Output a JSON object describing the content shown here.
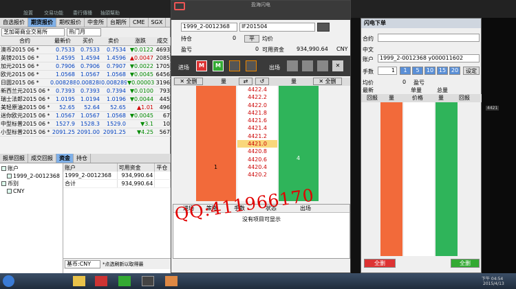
{
  "topmenu": [
    "設置",
    "交易功能",
    "委行傳播",
    "抽頭幫助"
  ],
  "main": {
    "tabs": [
      "自选报价",
      "期货报价",
      "期权报价",
      "中金所",
      "台期所",
      "CME",
      "SGX"
    ],
    "exchange": "芝加哥商业交易所",
    "month": "热门月",
    "cols": [
      "合约",
      "最新价",
      "买价",
      "卖价",
      "涨跌",
      "成交"
    ],
    "rows": [
      [
        "澳币2015 06 *",
        "0.7533",
        "0.7533",
        "0.7534",
        "▼0.0122",
        "4693"
      ],
      [
        "英镑2015 06 *",
        "1.4595",
        "1.4594",
        "1.4596",
        "▲0.0047",
        "2085"
      ],
      [
        "加元2015 06 *",
        "0.7906",
        "0.7906",
        "0.7907",
        "▼0.0022",
        "1705"
      ],
      [
        "欧元2015 06 *",
        "1.0568",
        "1.0567",
        "1.0568",
        "▼0.0045",
        "6456"
      ],
      [
        "日圆2015 06 *",
        "0.008288",
        "0.008288",
        "0.008289",
        "▼0.000039",
        "3196"
      ],
      [
        "新西兰元2015 06 *",
        "0.7393",
        "0.7393",
        "0.7394",
        "▼0.0100",
        "793"
      ],
      [
        "瑞士法郎2015 06 *",
        "1.0195",
        "1.0194",
        "1.0196",
        "▼0.0044",
        "445"
      ],
      [
        "美轻原油2015 06 *",
        "52.65",
        "52.64",
        "52.65",
        "▲1.01",
        "496"
      ],
      [
        "迷你欧元2015 06 *",
        "1.0567",
        "1.0567",
        "1.0568",
        "▼0.0045",
        "67"
      ],
      [
        "中型标普2015 06 *",
        "1527.9",
        "1528.3",
        "1529.0",
        "▼3.1",
        "10"
      ],
      [
        "小型标普2015 06 *",
        "2091.25",
        "2091.00",
        "2091.25",
        "▼4.25",
        "567"
      ]
    ],
    "bottom_tabs": [
      "报单回报",
      "成交回报",
      "资金",
      "持仓"
    ],
    "tree": [
      "账户",
      "1999_2-0012368",
      "币别",
      "CNY"
    ],
    "acct_cols": [
      "账户",
      "可用资金",
      "平仓"
    ],
    "acct_rows": [
      [
        "1999_2-0012368",
        "934,990.64"
      ],
      [
        "合计",
        "934,990.64"
      ]
    ],
    "base_label": "基币:CNY",
    "refresh_hint": "*点选刷新以取得最"
  },
  "flash": {
    "title": "盈海闪电",
    "account": "1999_2-0012368",
    "contract": "IF201504",
    "hold_lbl": "持仓",
    "hold_val": "0",
    "flat": "平",
    "avg_lbl": "均价",
    "pnl_lbl": "盈亏",
    "pnl_val": "0",
    "avail_lbl": "可用资金",
    "avail_val": "934,990.64",
    "cur": "CNY",
    "entry": "进场",
    "exit": "出场",
    "delall": "全删",
    "qty": "量",
    "prices": [
      "4422.4",
      "4422.2",
      "4422.0",
      "4421.8",
      "4421.6",
      "4421.4",
      "4421.2",
      "4421.0",
      "4420.8",
      "4420.6",
      "4420.4",
      "4420.2"
    ],
    "buyqty": "1",
    "sellqty": "4",
    "list_cols": [
      "进场",
      "策略",
      "手数",
      "状态",
      "出场"
    ],
    "empty": "没有项目可显示"
  },
  "right": {
    "title": "闪电下单",
    "contract_lbl": "合约",
    "chinese_lbl": "中文",
    "acct_lbl": "账户",
    "acct_val": "1999_2-0012368 y000011602",
    "qty_lbl": "手数",
    "qty_val": "1",
    "presets": [
      "1",
      "5",
      "10",
      "15",
      "20"
    ],
    "set": "设定",
    "avg_lbl": "均价",
    "avg_val": "0",
    "pnl_lbl": "盈亏",
    "latest": "最新",
    "single": "单量",
    "total": "总量",
    "recv": "回报",
    "qty": "量",
    "price": "价格",
    "qty2": "量",
    "recv2": "回报",
    "delall": "全删",
    "delall2": "全删"
  },
  "side": {
    "price": "4421",
    "clock": "下午 04:54",
    "date": "2015/4/13"
  },
  "watermark": "QQ:411966170"
}
